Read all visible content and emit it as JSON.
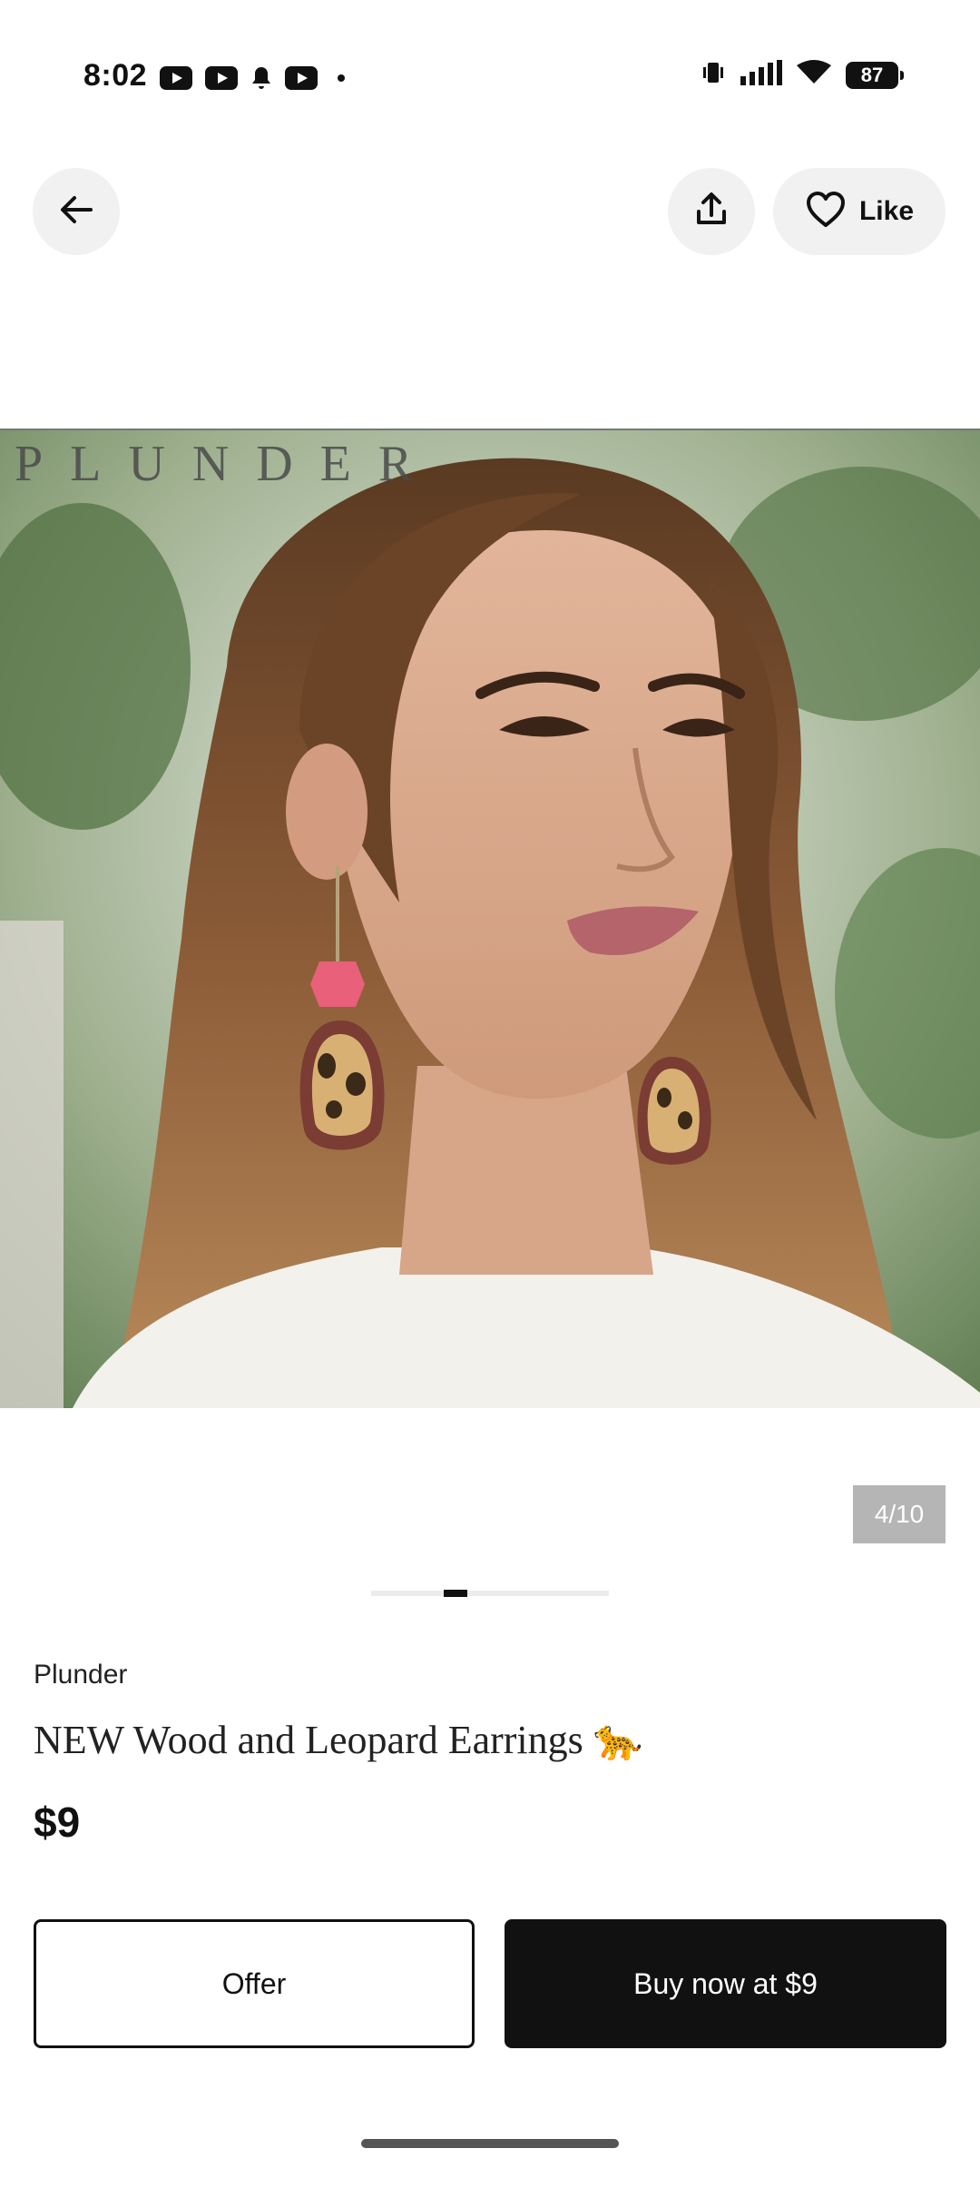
{
  "status_bar": {
    "time": "8:02",
    "battery": "87"
  },
  "nav": {
    "like_label": "Like"
  },
  "image": {
    "watermark": "PLUNDER",
    "counter": "4/10"
  },
  "listing": {
    "brand": "Plunder",
    "title": "NEW Wood and Leopard Earrings 🐆",
    "price": "$9"
  },
  "actions": {
    "offer_label": "Offer",
    "buy_label": "Buy now at $9"
  }
}
